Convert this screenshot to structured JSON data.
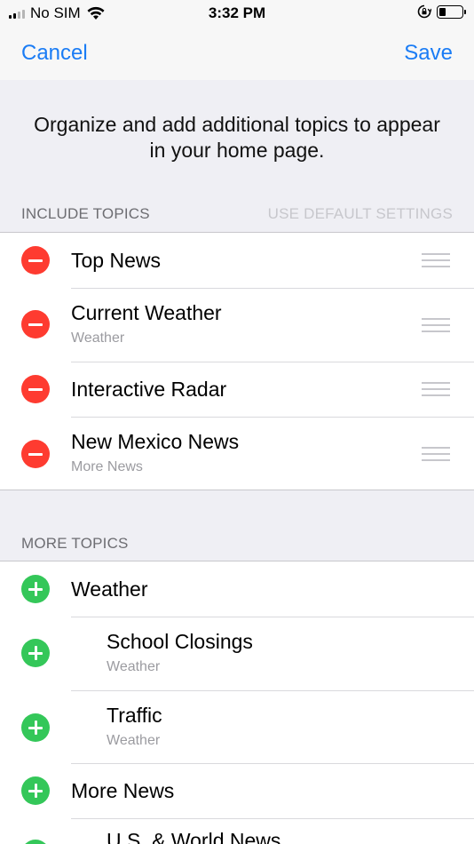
{
  "status_bar": {
    "carrier": "No SIM",
    "time": "3:32 PM",
    "battery_level": 0.3,
    "icons": [
      "signal-icon",
      "wifi-icon",
      "orientation-lock-icon",
      "battery-icon"
    ]
  },
  "nav": {
    "cancel_label": "Cancel",
    "save_label": "Save"
  },
  "intro_text": "Organize and add additional topics to appear in your home page.",
  "include_section": {
    "header": "INCLUDE TOPICS",
    "default_settings_label": "USE DEFAULT SETTINGS",
    "items": [
      {
        "title": "Top News",
        "subtitle": ""
      },
      {
        "title": "Current Weather",
        "subtitle": "Weather"
      },
      {
        "title": "Interactive Radar",
        "subtitle": ""
      },
      {
        "title": "New Mexico News",
        "subtitle": "More News"
      }
    ]
  },
  "more_section": {
    "header": "MORE TOPICS",
    "items": [
      {
        "title": "Weather",
        "subtitle": ""
      },
      {
        "title": "School Closings",
        "subtitle": "Weather"
      },
      {
        "title": "Traffic",
        "subtitle": "Weather"
      },
      {
        "title": "More News",
        "subtitle": ""
      },
      {
        "title": "U.S. & World News",
        "subtitle": ""
      }
    ]
  },
  "colors": {
    "accent": "#1a7cf5",
    "remove": "#fe3b30",
    "add": "#34c759",
    "background": "#efeff4"
  }
}
